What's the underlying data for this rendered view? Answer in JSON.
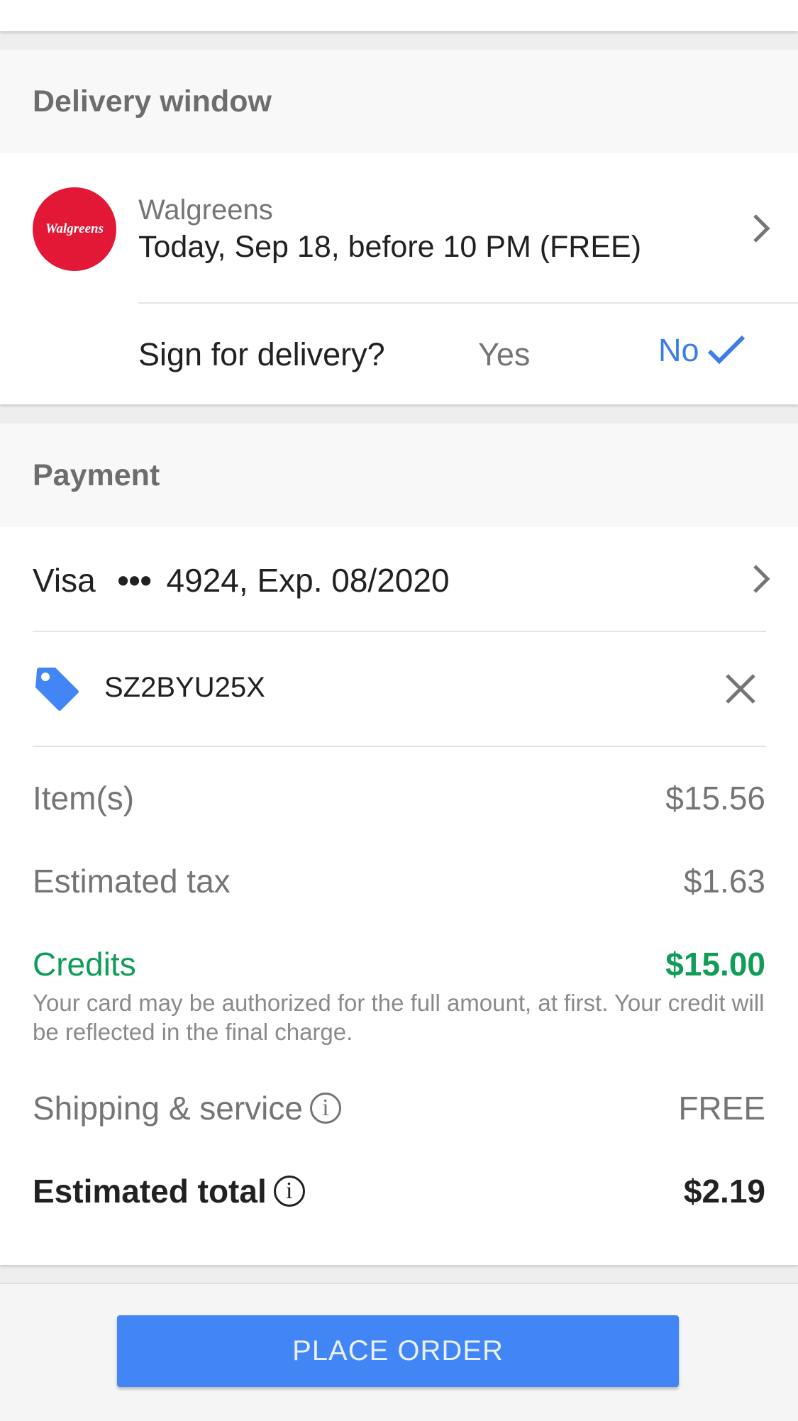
{
  "delivery": {
    "header": "Delivery window",
    "store_logo_text": "Walgreens",
    "store_name": "Walgreens",
    "window": "Today, Sep 18, before 10 PM (FREE)",
    "sign_question": "Sign for delivery?",
    "sign_yes": "Yes",
    "sign_no": "No"
  },
  "payment": {
    "header": "Payment",
    "card_brand": "Visa",
    "card_dots": "•••",
    "card_detail": "4924, Exp. 08/2020",
    "promo_code": "SZ2BYU25X"
  },
  "summary": {
    "items_label": "Item(s)",
    "items_value": "$15.56",
    "tax_label": "Estimated tax",
    "tax_value": "$1.63",
    "credits_label": "Credits",
    "credits_value": "$15.00",
    "credits_note": "Your card may be authorized for the full amount, at first. Your credit will be reflected in the final charge.",
    "shipping_label": "Shipping & service",
    "shipping_value": "FREE",
    "total_label": "Estimated total",
    "total_value": "$2.19"
  },
  "actions": {
    "place_order": "PLACE ORDER"
  },
  "colors": {
    "accent_blue": "#4285f4",
    "link_blue": "#3d7ee6",
    "credit_green": "#0f9d58",
    "walgreens_red": "#e31837"
  },
  "icons": {
    "info": "i"
  }
}
